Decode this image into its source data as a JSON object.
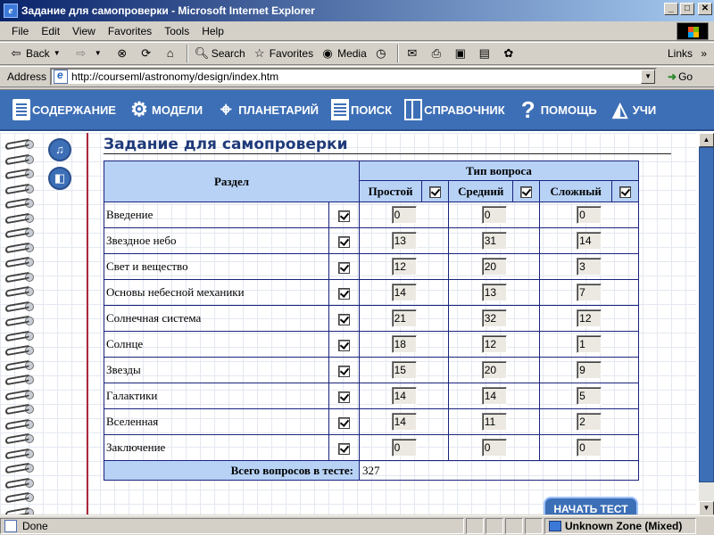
{
  "window": {
    "title": "Задание для самопроверки - Microsoft Internet Explorer",
    "app_icon": "ie-icon"
  },
  "menu": [
    {
      "label": "File",
      "accel": "F"
    },
    {
      "label": "Edit",
      "accel": "E"
    },
    {
      "label": "View",
      "accel": "V"
    },
    {
      "label": "Favorites",
      "accel": "a"
    },
    {
      "label": "Tools",
      "accel": "T"
    },
    {
      "label": "Help",
      "accel": "H"
    }
  ],
  "toolbar": {
    "back": "Back",
    "search": "Search",
    "favorites": "Favorites",
    "media": "Media",
    "links": "Links"
  },
  "address": {
    "label": "Address",
    "url": "http://courseml/astronomy/design/index.htm",
    "go": "Go"
  },
  "site_nav": [
    {
      "label": "СОДЕРЖАНИЕ",
      "icon": "book-icon"
    },
    {
      "label": "МОДЕЛИ",
      "icon": "gears-icon"
    },
    {
      "label": "ПЛАНЕТАРИЙ",
      "icon": "telescope-icon"
    },
    {
      "label": "ПОИСК",
      "icon": "search-doc-icon"
    },
    {
      "label": "СПРАВОЧНИК",
      "icon": "reference-icon"
    },
    {
      "label": "ПОМОЩЬ",
      "icon": "help-icon"
    },
    {
      "label": "УЧИ",
      "icon": "graduation-cap-icon"
    }
  ],
  "page": {
    "heading": "Задание для самопроверки",
    "table": {
      "section_header": "Раздел",
      "type_header": "Тип вопроса",
      "columns": [
        "Простой",
        "Средний",
        "Сложный"
      ],
      "header_checks": [
        true,
        true,
        true
      ],
      "rows": [
        {
          "name": "Введение",
          "checked": true,
          "easy": "0",
          "medium": "0",
          "hard": "0"
        },
        {
          "name": "Звездное небо",
          "checked": true,
          "easy": "13",
          "medium": "31",
          "hard": "14"
        },
        {
          "name": "Свет и вещество",
          "checked": true,
          "easy": "12",
          "medium": "20",
          "hard": "3"
        },
        {
          "name": "Основы небесной механики",
          "checked": true,
          "easy": "14",
          "medium": "13",
          "hard": "7"
        },
        {
          "name": "Солнечная система",
          "checked": true,
          "easy": "21",
          "medium": "32",
          "hard": "12"
        },
        {
          "name": "Солнце",
          "checked": true,
          "easy": "18",
          "medium": "12",
          "hard": "1"
        },
        {
          "name": "Звезды",
          "checked": true,
          "easy": "15",
          "medium": "20",
          "hard": "9"
        },
        {
          "name": "Галактики",
          "checked": true,
          "easy": "14",
          "medium": "14",
          "hard": "5"
        },
        {
          "name": "Вселенная",
          "checked": true,
          "easy": "14",
          "medium": "11",
          "hard": "2"
        },
        {
          "name": "Заключение",
          "checked": true,
          "easy": "0",
          "medium": "0",
          "hard": "0"
        }
      ],
      "total_label": "Всего вопросов в тесте:",
      "total_value": "327"
    },
    "start_button": "НАЧАТЬ ТЕСТ",
    "side_buttons": [
      {
        "icon": "music-note-icon"
      },
      {
        "icon": "speaker-icon"
      }
    ]
  },
  "status": {
    "text": "Done",
    "zone": "Unknown Zone (Mixed)"
  },
  "colors": {
    "nav_bg": "#3d6fb6",
    "table_header_bg": "#b7d2f5",
    "heading_color": "#1f3a7a",
    "table_border": "#1a237e"
  }
}
